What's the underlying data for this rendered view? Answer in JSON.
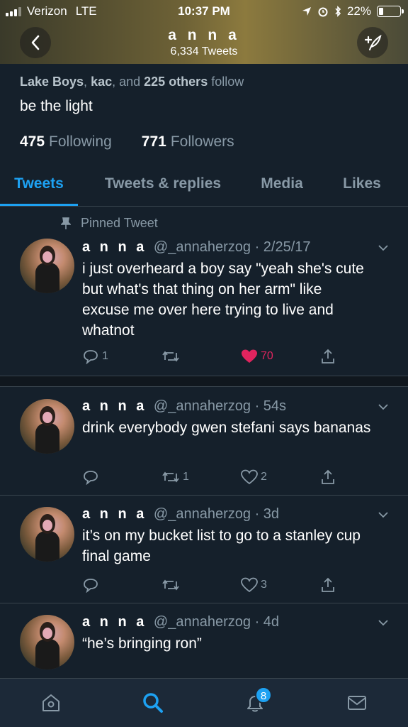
{
  "status_bar": {
    "carrier": "Verizon",
    "network": "LTE",
    "time": "10:37 PM",
    "battery": "22%",
    "battery_level": 0.22
  },
  "nav": {
    "name": "a n n a",
    "tweet_count": "6,334 Tweets"
  },
  "profile": {
    "followed_by": [
      "Lake Boys",
      ", ",
      "kac",
      ", and ",
      "225 others",
      " follow"
    ],
    "bio": "be the light",
    "following_count": "475",
    "following_label": "Following",
    "followers_count": "771",
    "followers_label": "Followers"
  },
  "tabs": [
    {
      "label": "Tweets",
      "active": true
    },
    {
      "label": "Tweets & replies",
      "active": false
    },
    {
      "label": "Media",
      "active": false
    },
    {
      "label": "Likes",
      "active": false
    }
  ],
  "tweets": [
    {
      "pinned_label": "Pinned Tweet",
      "name": "a n n a",
      "handle": "@_annaherzog",
      "sep": "·",
      "time": "2/25/17",
      "text": "i just overheard a boy say \"yeah she's cute but what's that thing on her arm\" like excuse me over here trying to live and whatnot",
      "replies": "1",
      "retweets": "",
      "likes": "70"
    },
    {
      "name": "a n n a",
      "handle": "@_annaherzog",
      "sep": "·",
      "time": "54s",
      "text": "drink everybody gwen stefani says bananas",
      "replies": "",
      "retweets": "1",
      "likes": "2"
    },
    {
      "name": "a n n a",
      "handle": "@_annaherzog",
      "sep": "·",
      "time": "3d",
      "text": "it’s on my bucket list to go to a stanley cup final game",
      "replies": "",
      "retweets": "",
      "likes": "3"
    },
    {
      "name": "a n n a",
      "handle": "@_annaherzog",
      "sep": "·",
      "time": "4d",
      "text": "“he’s bringing ron”"
    }
  ],
  "bottom_bar": {
    "notifications_badge": "8"
  },
  "colors": {
    "accent": "#1da1f2",
    "like": "#e0245e",
    "background": "#15202b",
    "muted": "#8899a6"
  }
}
